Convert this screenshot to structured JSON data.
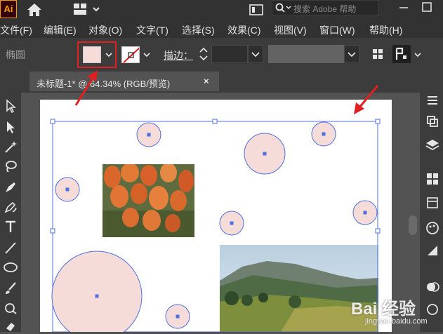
{
  "app": {
    "logo_text": "Ai",
    "search_placeholder": "搜索 Adobe 帮助"
  },
  "menu": [
    {
      "label": "文件(F)"
    },
    {
      "label": "编辑(E)"
    },
    {
      "label": "对象(O)"
    },
    {
      "label": "文字(T)"
    },
    {
      "label": "选择(S)"
    },
    {
      "label": "效果(C)"
    },
    {
      "label": "视图(V)"
    },
    {
      "label": "窗口(W)"
    },
    {
      "label": "帮助(H)"
    }
  ],
  "control_bar": {
    "selection_type": "椭圆",
    "fill_color": "#f5dcd8",
    "stroke_color": "none",
    "stroke_label": "描边：",
    "stroke_width": ""
  },
  "document": {
    "tab_title": "未标题-1* @ 64.34% (RGB/预览)",
    "close_glyph": "×"
  },
  "colors": {
    "highlight": "#e02020",
    "selection": "#4f6fe0",
    "circle_fill": "#f5dcd8"
  },
  "watermark": {
    "text": "Bai 经验",
    "sub": "jingyan.baidu.com"
  }
}
